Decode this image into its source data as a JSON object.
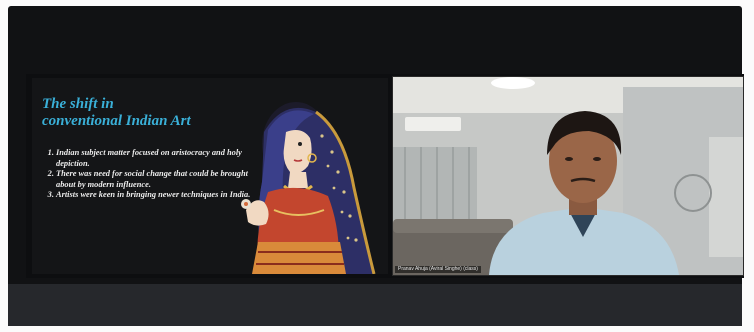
{
  "slide": {
    "title_line1": "The shift in",
    "title_line2": "conventional Indian Art",
    "points": [
      "Indian subject matter focused on aristocracy and holy depiction.",
      "There was need for social change that could be brought about by modern influence.",
      "Artists were keen in bringing newer techniques in India."
    ],
    "image_icon": "painting-woman-portrait"
  },
  "video": {
    "participant_name": "Pranav Ahuja (Aviral Singhe) (class)"
  },
  "colors": {
    "title_accent": "#3ab0d8",
    "screen_background": "#111214"
  }
}
